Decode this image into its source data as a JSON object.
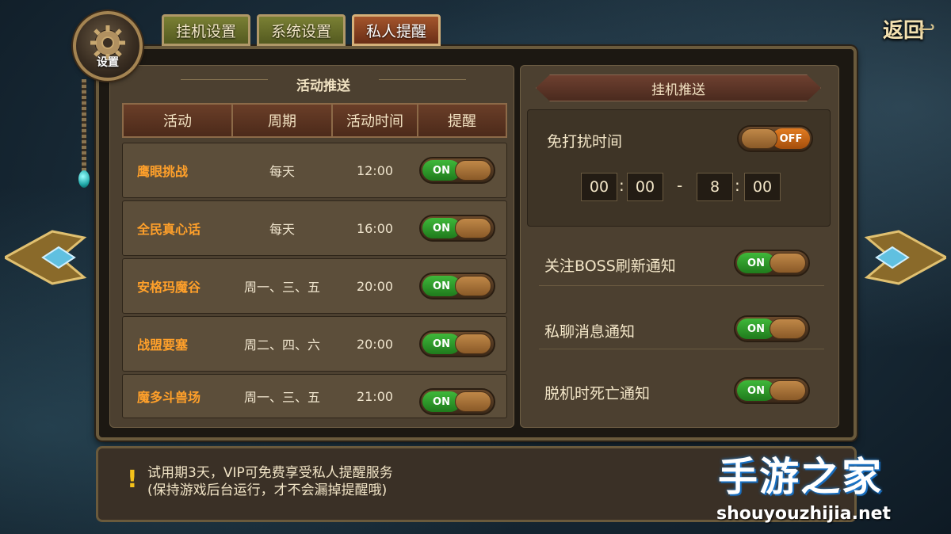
{
  "badge": {
    "label": "设置"
  },
  "tabs": [
    {
      "label": "挂机设置",
      "active": false
    },
    {
      "label": "系统设置",
      "active": false
    },
    {
      "label": "私人提醒",
      "active": true
    }
  ],
  "back_label": "返回",
  "activity_push": {
    "title": "活动推送",
    "columns": [
      "活动",
      "周期",
      "活动时间",
      "提醒"
    ],
    "rows": [
      {
        "name": "鹰眼挑战",
        "cycle": "每天",
        "time": "12:00",
        "toggle": "ON"
      },
      {
        "name": "全民真心话",
        "cycle": "每天",
        "time": "16:00",
        "toggle": "ON"
      },
      {
        "name": "安格玛魔谷",
        "cycle": "周一、三、五",
        "time": "20:00",
        "toggle": "ON"
      },
      {
        "name": "战盟要塞",
        "cycle": "周二、四、六",
        "time": "20:00",
        "toggle": "ON"
      },
      {
        "name": "魔多斗兽场",
        "cycle": "周一、三、五",
        "time": "21:00",
        "toggle": "ON"
      }
    ]
  },
  "idle_push": {
    "title": "挂机推送",
    "dnd_label": "免打扰时间",
    "dnd_toggle": "OFF",
    "start_hour": "00",
    "start_min": "00",
    "dash": "-",
    "end_hour": "8",
    "end_min": "00",
    "colon": ":",
    "notices": [
      {
        "label": "关注BOSS刷新通知",
        "toggle": "ON"
      },
      {
        "label": "私聊消息通知",
        "toggle": "ON"
      },
      {
        "label": "脱机时死亡通知",
        "toggle": "ON"
      }
    ]
  },
  "footer": {
    "icon": "!",
    "line1": "试用期3天，VIP可免费享受私人提醒服务",
    "line2": "(保持游戏后台运行，才不会漏掉提醒哦)"
  },
  "watermark": {
    "title": "手游之家",
    "url": "shouyouzhijia.net"
  },
  "colors": {
    "on_green": "#2e9a2a",
    "off_orange": "#d0701a",
    "activity_name": "#ffa02a"
  }
}
